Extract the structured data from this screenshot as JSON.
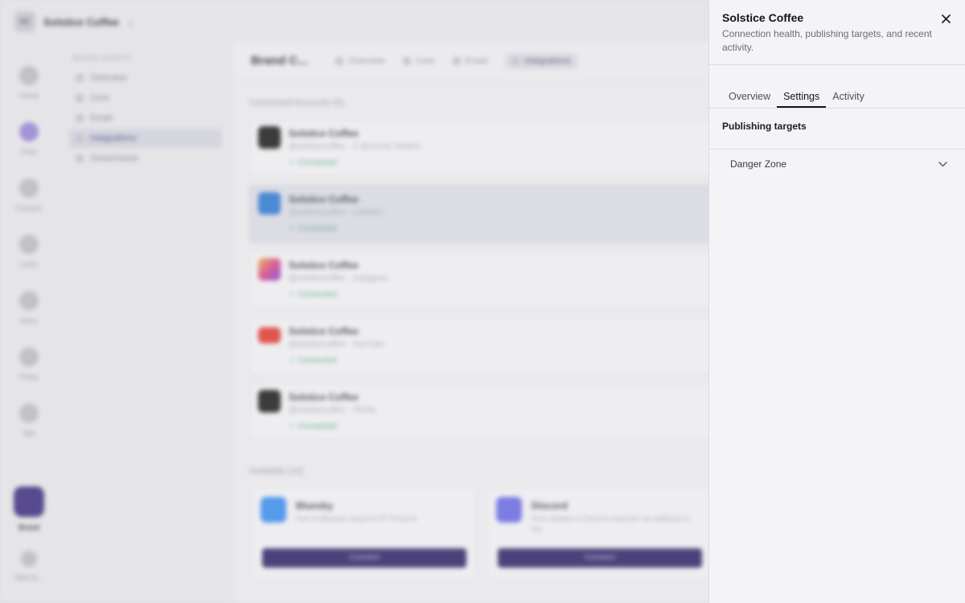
{
  "workspace": {
    "initials": "SC",
    "name": "Solstice Coffee"
  },
  "rail": [
    {
      "label": "Home",
      "icon": "home-icon"
    },
    {
      "label": "Post",
      "icon": "post-icon"
    },
    {
      "label": "Content",
      "icon": "content-icon"
    },
    {
      "label": "Links",
      "icon": "links-icon"
    },
    {
      "label": "Inbox",
      "icon": "inbox-icon"
    },
    {
      "label": "Flows",
      "icon": "flows-icon"
    },
    {
      "label": "Site",
      "icon": "site-icon"
    },
    {
      "label": "Brand",
      "icon": "brand-icon"
    },
    {
      "label": "New br...",
      "icon": "plus-icon"
    }
  ],
  "subnav": {
    "heading": "BRAND ASSETS",
    "items": [
      "Overview",
      "Core",
      "Email",
      "Integrations",
      "Governance"
    ]
  },
  "main": {
    "title": "Brand C...",
    "tabs": [
      "Overview",
      "Core",
      "Email",
      "Integrations"
    ],
    "connected_heading": "Connected Accounts (5)",
    "accounts": [
      {
        "name": "Solstice Coffee",
        "sub": "@solsticecoffee · X (formerly Twitter)",
        "status": "Connected",
        "color": "#1a1a1a"
      },
      {
        "name": "Solstice Coffee",
        "sub": "@solsticecoffee · LinkedIn",
        "status": "Connected",
        "color": "#2f7ad3"
      },
      {
        "name": "Solstice Coffee",
        "sub": "@solsticecoffee · Instagram",
        "status": "Connected",
        "color": "#d9468a"
      },
      {
        "name": "Solstice Coffee",
        "sub": "@solsticecoffee · YouTube",
        "status": "Connected",
        "color": "#e23a2f"
      },
      {
        "name": "Solstice Coffee",
        "sub": "@solsticecoffee · TikTok",
        "status": "Connected",
        "color": "#1a1a1a"
      }
    ],
    "available_heading": "Available (10)",
    "available": [
      {
        "name": "Bluesky",
        "desc": "Post to Bluesky using the AT Protocol",
        "button": "Connect",
        "color": "#3a8ef0"
      },
      {
        "name": "Discord",
        "desc": "Post updates to Discord channels via webhook or bot",
        "button": "Connect",
        "color": "#6a6ae6"
      }
    ]
  },
  "drawer": {
    "title": "Solstice Coffee",
    "subtitle": "Connection health, publishing targets, and recent activity.",
    "tabs": [
      "Overview",
      "Settings",
      "Activity"
    ],
    "active_tab": "Settings",
    "publishing_targets_label": "Publishing targets",
    "danger_zone_label": "Danger Zone"
  },
  "colors": {
    "accent": "#2d2366",
    "connected": "#4fa17c"
  }
}
